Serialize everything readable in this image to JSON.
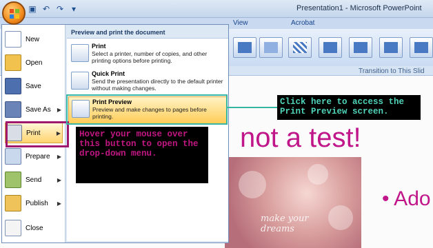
{
  "window": {
    "title": "Presentation1 - Microsoft PowerPoint"
  },
  "ribbon": {
    "tabs": [
      "View",
      "Acrobat"
    ],
    "group_label": "Transition to This Slid"
  },
  "office_menu": {
    "items": [
      {
        "label": "New",
        "arrow": ""
      },
      {
        "label": "Open",
        "arrow": ""
      },
      {
        "label": "Save",
        "arrow": ""
      },
      {
        "label": "Save As",
        "arrow": "▶"
      },
      {
        "label": "Print",
        "arrow": "▶"
      },
      {
        "label": "Prepare",
        "arrow": "▶"
      },
      {
        "label": "Send",
        "arrow": "▶"
      },
      {
        "label": "Publish",
        "arrow": "▶"
      },
      {
        "label": "Close",
        "arrow": ""
      }
    ],
    "submenu": {
      "header": "Preview and print the document",
      "entries": [
        {
          "title": "Print",
          "desc": "Select a printer, number of copies, and other printing options before printing."
        },
        {
          "title": "Quick Print",
          "desc": "Send the presentation directly to the default printer without making changes."
        },
        {
          "title": "Print Preview",
          "desc": "Preview and make changes to pages before printing."
        }
      ]
    }
  },
  "callouts": {
    "print": "Hover your mouse over this button to open the drop-down menu.",
    "preview": "Click here to access the Print Preview screen."
  },
  "slide": {
    "title": "not a test!",
    "bullet": "• Ado",
    "photo_text": "make your\ndreams"
  },
  "colors": {
    "accent": "#c0168a",
    "callout_teal": "#35b6a3"
  }
}
